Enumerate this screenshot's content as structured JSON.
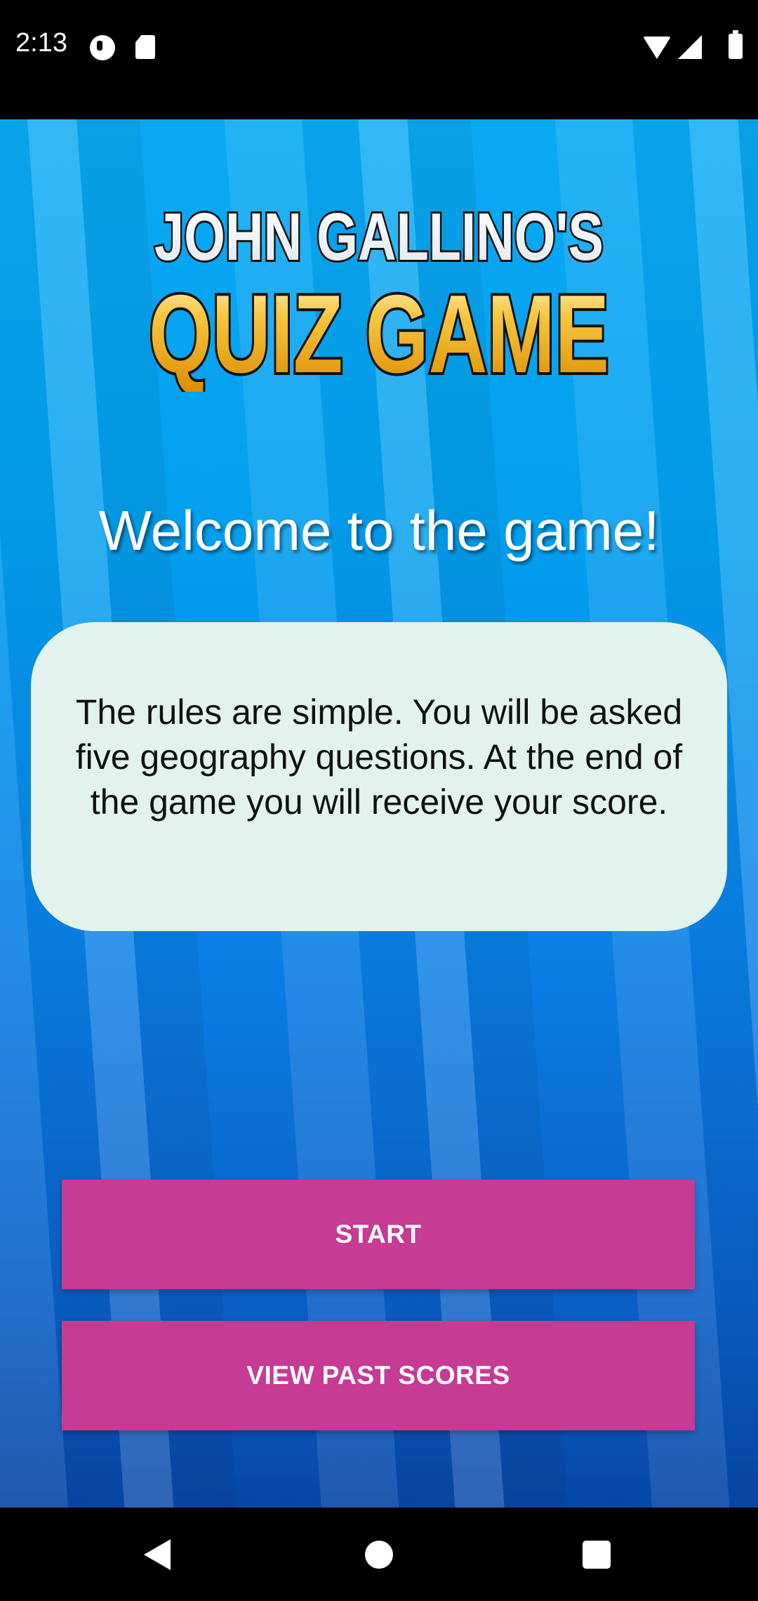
{
  "status_bar": {
    "time": "2:13",
    "left_icons": [
      "app-notification-icon",
      "sd-card-icon"
    ],
    "right_icons": [
      "wifi-icon",
      "signal-icon",
      "battery-icon"
    ]
  },
  "logo": {
    "line1": "JOHN GALLINO'S",
    "line2": "QUIZ GAME"
  },
  "welcome_title": "Welcome to the game!",
  "rules_text": "The rules are simple. You will be asked five geography questions. At the end of the game you will receive your score.",
  "buttons": {
    "start_label": "START",
    "scores_label": "VIEW PAST SCORES"
  },
  "colors": {
    "background": "#039fef",
    "card": "#e2f3ee",
    "button": "#c63b93",
    "logo_gold": "#f0a800"
  },
  "nav_bar": {
    "icons": [
      "back-icon",
      "home-icon",
      "recents-icon"
    ]
  }
}
